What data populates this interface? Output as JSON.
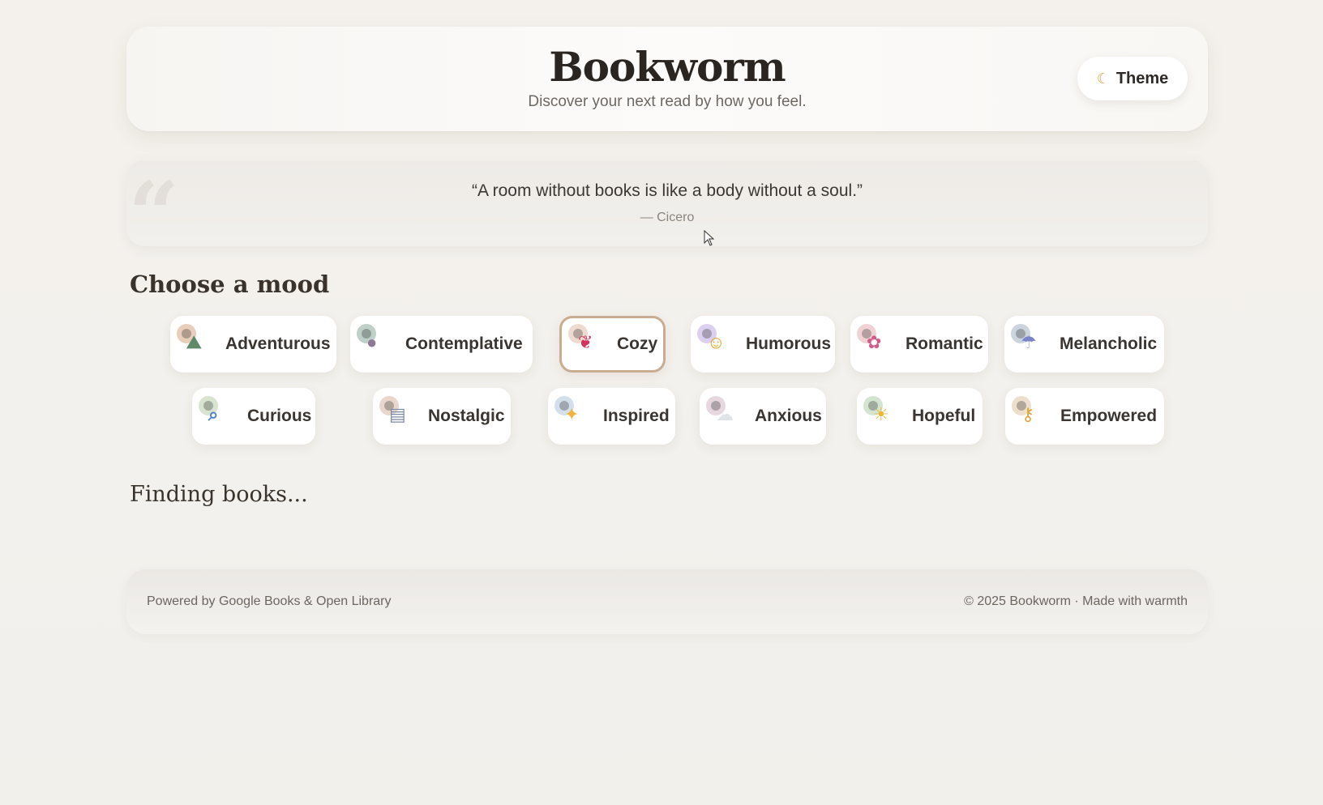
{
  "header": {
    "title": "Bookworm",
    "subtitle": "Discover your next read by how you feel.",
    "theme_button": {
      "icon": "moon-icon",
      "label": "Theme"
    }
  },
  "quote": {
    "text": "“A room without books is like a body without a soul.”",
    "author": "— Cicero",
    "decor_icon": "quote-mark-icon"
  },
  "moods": {
    "heading": "Choose a mood",
    "selected": "Cozy",
    "row1": [
      {
        "label": "Adventurous",
        "icon": "mountain-icon",
        "accent": "#c89a78"
      },
      {
        "label": "Contemplative",
        "icon": "thought-icon",
        "accent": "#8aa39a"
      },
      {
        "label": "Cozy",
        "icon": "blanket-icon",
        "accent": "#d9b9a8"
      },
      {
        "label": "Humorous",
        "icon": "laughing-face-icon",
        "accent": "#b9a2d6"
      },
      {
        "label": "Romantic",
        "icon": "bouquet-icon",
        "accent": "#d8a7a9"
      },
      {
        "label": "Melancholic",
        "icon": "rain-cloud-icon",
        "accent": "#9aa7b5"
      }
    ],
    "row2": [
      {
        "label": "Curious",
        "icon": "magnifier-icon",
        "accent": "#a9bf9a"
      },
      {
        "label": "Nostalgic",
        "icon": "radio-icon",
        "accent": "#c8a593"
      },
      {
        "label": "Inspired",
        "icon": "sparkles-icon",
        "accent": "#9fb9cf"
      },
      {
        "label": "Anxious",
        "icon": "cloud-icon",
        "accent": "#c6a8b5"
      },
      {
        "label": "Hopeful",
        "icon": "sun-cloud-icon",
        "accent": "#a3c49d"
      },
      {
        "label": "Empowered",
        "icon": "key-icon",
        "accent": "#d4b18f"
      }
    ]
  },
  "status": {
    "text": "Finding books..."
  },
  "footer": {
    "left": "Powered by Google Books & Open Library",
    "right": "© 2025 Bookworm · Made with warmth"
  },
  "colors": {
    "background": "#f3f1ed",
    "selected_border": "#c9ad92",
    "text": "#2a2622"
  }
}
